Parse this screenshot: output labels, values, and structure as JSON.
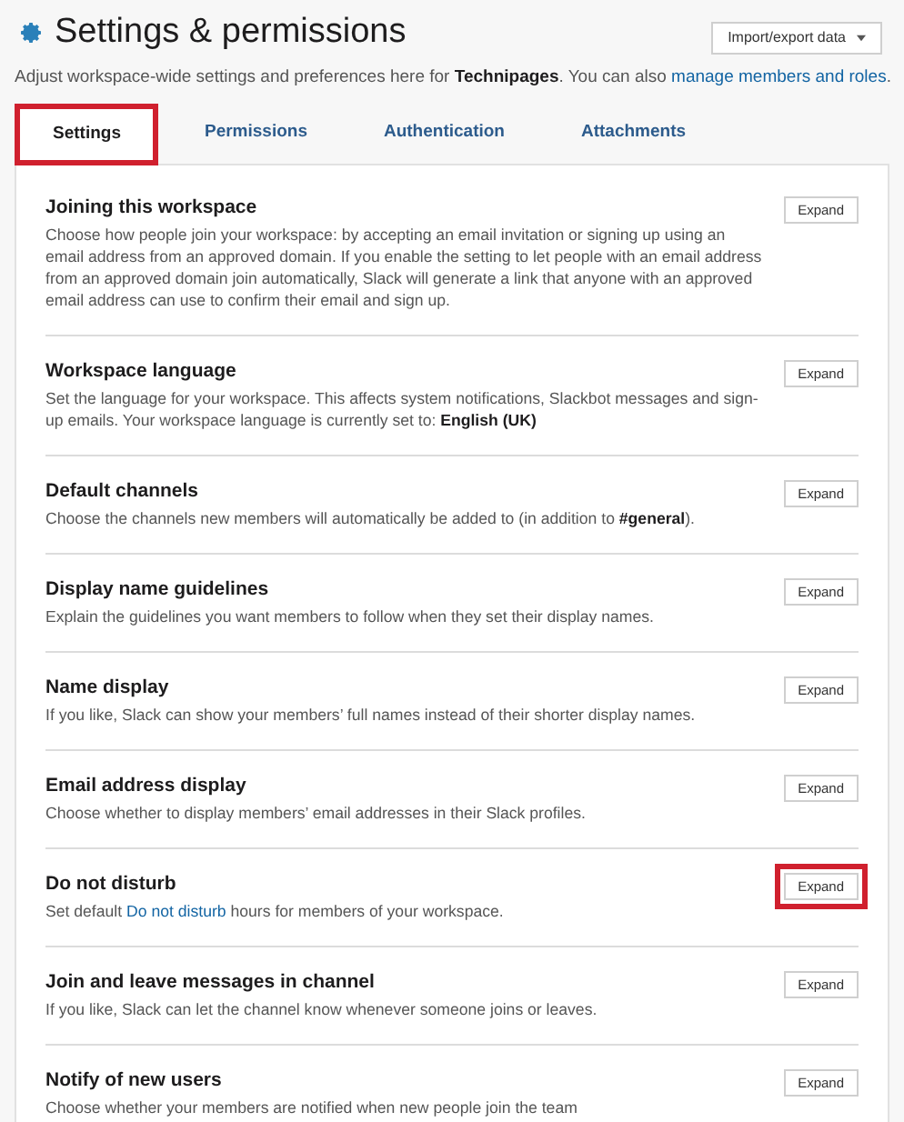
{
  "header": {
    "title": "Settings & permissions",
    "action_button": "Import/export data",
    "subtitle": [
      {
        "kind": "plain",
        "text": "Adjust workspace-wide settings and preferences here for "
      },
      {
        "kind": "bold",
        "text": "Technipages"
      },
      {
        "kind": "plain",
        "text": ". You can also "
      },
      {
        "kind": "link",
        "text": "manage members and roles"
      },
      {
        "kind": "plain",
        "text": "."
      }
    ]
  },
  "tabs": [
    {
      "label": "Settings",
      "selected": true,
      "highlighted": true
    },
    {
      "label": "Permissions",
      "selected": false,
      "highlighted": false
    },
    {
      "label": "Authentication",
      "selected": false,
      "highlighted": false
    },
    {
      "label": "Attachments",
      "selected": false,
      "highlighted": false
    }
  ],
  "sections": [
    {
      "title": "Joining this workspace",
      "button": "Expand",
      "highlighted": false,
      "description": [
        {
          "kind": "plain",
          "text": "Choose how people join your workspace: by accepting an email invitation or signing up using an email address from an approved domain. If you enable the setting to let people with an email address from an approved domain join automatically, Slack will generate a link that anyone with an approved email address can use to confirm their email and sign up."
        }
      ]
    },
    {
      "title": "Workspace language",
      "button": "Expand",
      "highlighted": false,
      "description": [
        {
          "kind": "plain",
          "text": "Set the language for your workspace. This affects system notifications, Slackbot messages and sign-up emails. Your workspace language is currently set to: "
        },
        {
          "kind": "bold",
          "text": "English (UK)"
        }
      ]
    },
    {
      "title": "Default channels",
      "button": "Expand",
      "highlighted": false,
      "description": [
        {
          "kind": "plain",
          "text": "Choose the channels new members will automatically be added to (in addition to "
        },
        {
          "kind": "bold",
          "text": "#general"
        },
        {
          "kind": "plain",
          "text": ")."
        }
      ]
    },
    {
      "title": "Display name guidelines",
      "button": "Expand",
      "highlighted": false,
      "description": [
        {
          "kind": "plain",
          "text": "Explain the guidelines you want members to follow when they set their display names."
        }
      ]
    },
    {
      "title": "Name display",
      "button": "Expand",
      "highlighted": false,
      "description": [
        {
          "kind": "plain",
          "text": "If you like, Slack can show your members’ full names instead of their shorter display names."
        }
      ]
    },
    {
      "title": "Email address display",
      "button": "Expand",
      "highlighted": false,
      "description": [
        {
          "kind": "plain",
          "text": "Choose whether to display members’ email addresses in their Slack profiles."
        }
      ]
    },
    {
      "title": "Do not disturb",
      "button": "Expand",
      "highlighted": true,
      "description": [
        {
          "kind": "plain",
          "text": "Set default "
        },
        {
          "kind": "link",
          "text": "Do not disturb"
        },
        {
          "kind": "plain",
          "text": " hours for members of your workspace."
        }
      ]
    },
    {
      "title": "Join and leave messages in channel",
      "button": "Expand",
      "highlighted": false,
      "description": [
        {
          "kind": "plain",
          "text": "If you like, Slack can let the channel know whenever someone joins or leaves."
        }
      ]
    },
    {
      "title": "Notify of new users",
      "button": "Expand",
      "highlighted": false,
      "description": [
        {
          "kind": "plain",
          "text": "Choose whether your members are notified when new people join the team"
        }
      ]
    }
  ]
}
